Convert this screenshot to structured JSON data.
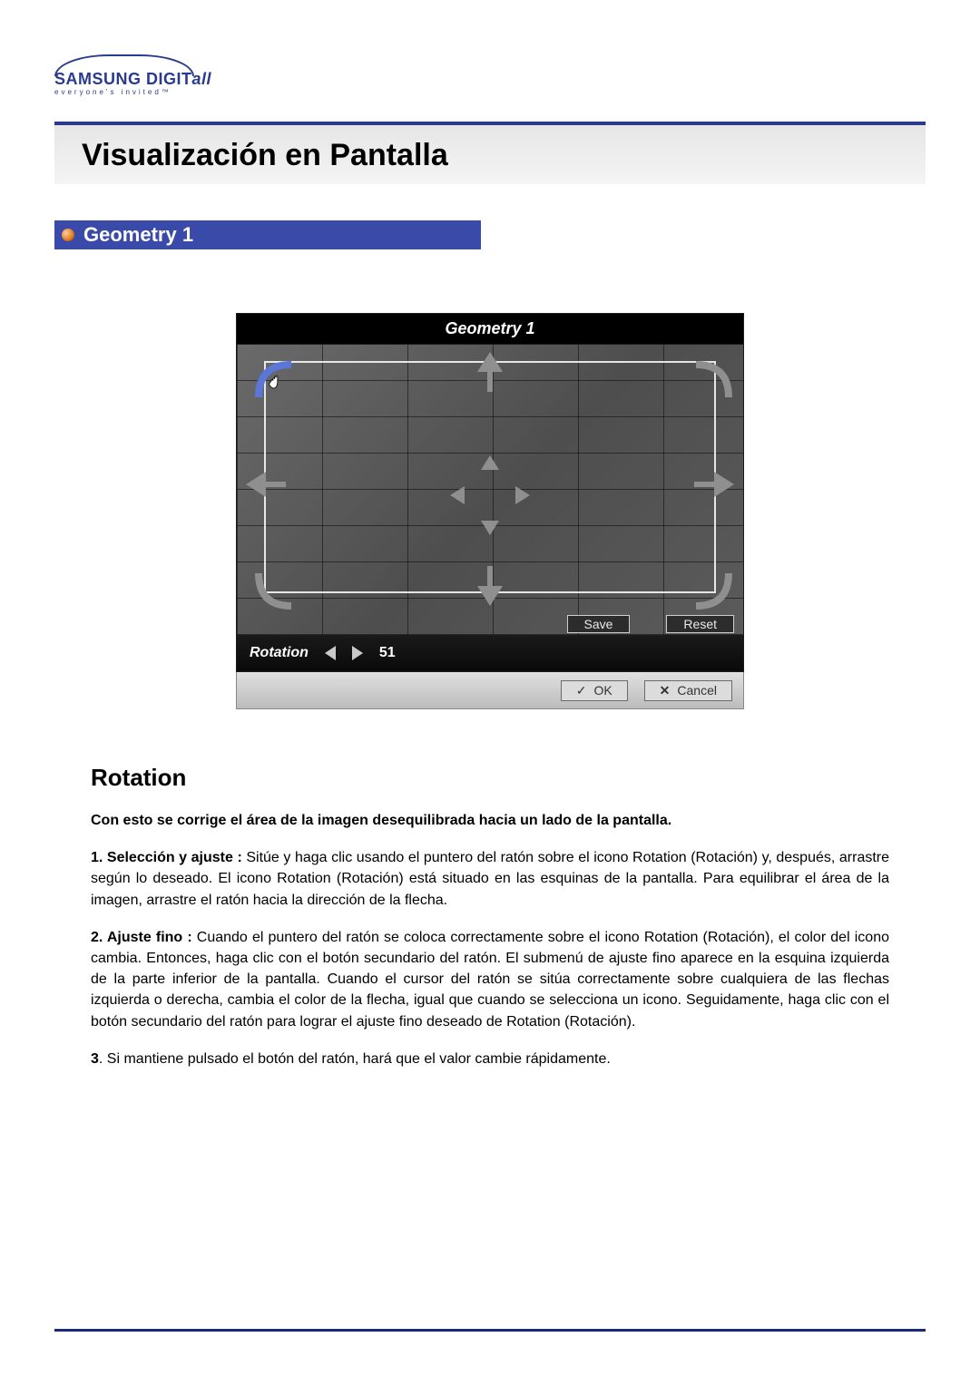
{
  "logo": {
    "line1_prefix": "SAMSUNG DIGIT",
    "line1_suffix": "all",
    "line2": "everyone's invited™"
  },
  "page_title": "Visualización en Pantalla",
  "section_title": "Geometry 1",
  "osd": {
    "title": "Geometry 1",
    "save_label": "Save",
    "reset_label": "Reset",
    "fine_label": "Rotation",
    "fine_value": "51",
    "ok_label": "OK",
    "cancel_label": "Cancel",
    "icons": {
      "corner_tl": "rotation-corner-top-left",
      "corner_tr": "rotation-corner-top-right",
      "corner_bl": "rotation-corner-bottom-left",
      "corner_br": "rotation-corner-bottom-right",
      "arrow_up": "position-up",
      "arrow_down": "position-down",
      "arrow_left": "position-left",
      "arrow_right": "position-right"
    }
  },
  "body": {
    "heading": "Rotation",
    "lead": "Con esto se corrige el área de la imagen desequilibrada hacia un lado de la pantalla.",
    "p1_label": "1. Selección y ajuste :",
    "p1_text": " Sitúe y haga clic usando el puntero del ratón sobre el icono Rotation (Rotación) y, después, arrastre según lo deseado. El icono Rotation (Rotación) está situado en las esquinas de la pantalla. Para equilibrar el área de la imagen, arrastre el ratón hacia la dirección de la flecha.",
    "p2_label": "2. Ajuste fino :",
    "p2_text": " Cuando el puntero del ratón se coloca correctamente sobre el icono Rotation (Rotación), el color del icono cambia. Entonces, haga clic con el botón secundario del ratón. El submenú de ajuste fino aparece en la esquina izquierda de la parte inferior de la pantalla. Cuando el cursor del ratón se sitúa correctamente sobre cualquiera de las flechas izquierda o derecha, cambia el color de la flecha, igual que cuando se selecciona un icono. Seguidamente, haga clic con el botón secundario del ratón para lograr el ajuste fino deseado de Rotation (Rotación).",
    "p3_label": "3",
    "p3_text": ". Si mantiene pulsado el botón del ratón, hará que el valor cambie rápidamente."
  }
}
